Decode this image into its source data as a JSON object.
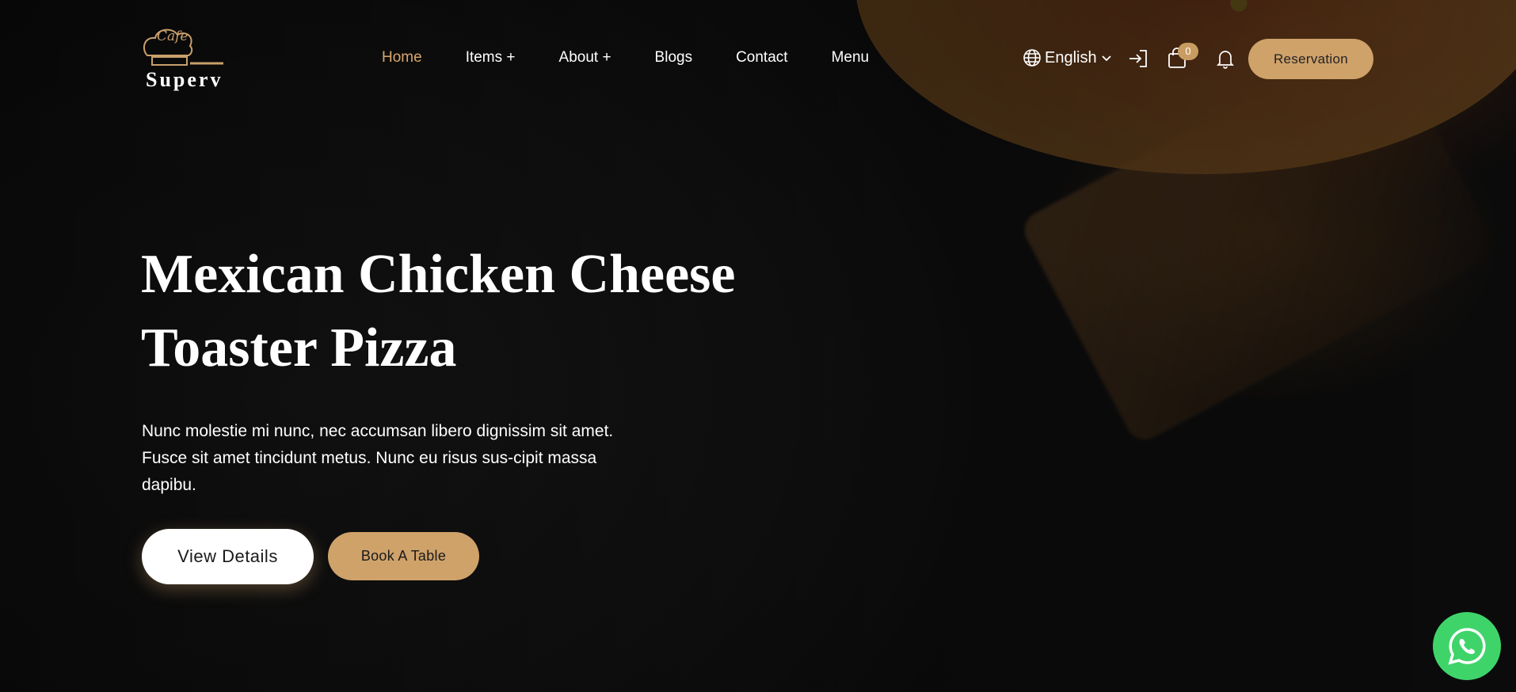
{
  "brand": {
    "logo_cafe": "Cafe",
    "logo_name": "Superv"
  },
  "nav": {
    "items": [
      {
        "label": "Home",
        "active": true
      },
      {
        "label": "Items +"
      },
      {
        "label": "About +"
      },
      {
        "label": "Blogs"
      },
      {
        "label": "Contact"
      },
      {
        "label": "Menu"
      }
    ]
  },
  "header": {
    "language": "English",
    "cart_count": "0",
    "reservation_label": "Reservation",
    "icons": [
      "globe-icon",
      "chevron-down-icon",
      "login-icon",
      "shopping-bag-icon",
      "bell-icon"
    ]
  },
  "hero": {
    "title_line1": "Mexican Chicken Cheese",
    "title_line2": "Toaster Pizza",
    "description_line1": "Nunc molestie mi nunc, nec accumsan libero dignissim sit amet.",
    "description_line2": "Fusce sit amet tincidunt metus. Nunc eu risus sus-cipit massa",
    "description_line3": "dapibu.",
    "view_details_label": "View Details",
    "book_table_label": "Book A Table"
  },
  "colors": {
    "accent": "#cfa26a",
    "active_nav": "#d9a76b",
    "whatsapp": "#3fd46a"
  }
}
